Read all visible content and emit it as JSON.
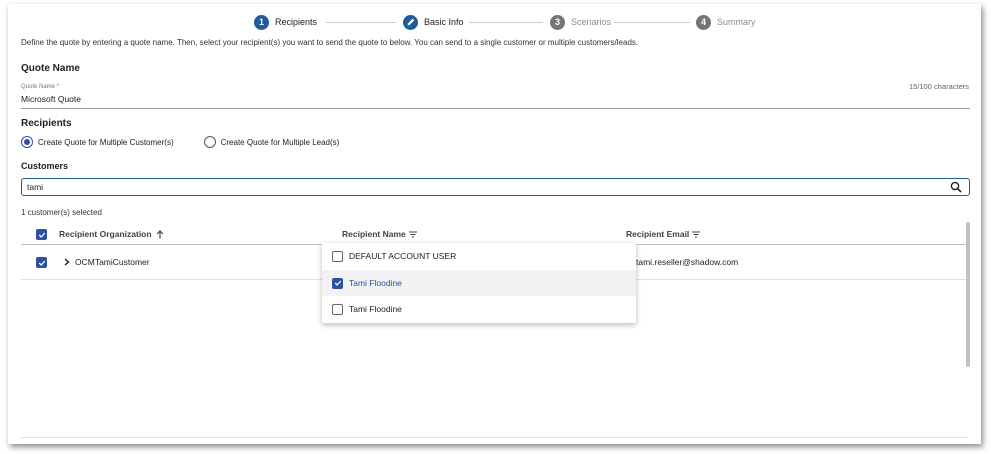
{
  "stepper": {
    "steps": [
      {
        "number": "1",
        "label": "Recipients",
        "state": "active"
      },
      {
        "number": "",
        "label": "Basic Info",
        "state": "done",
        "icon": "pencil-icon"
      },
      {
        "number": "3",
        "label": "Scenarios",
        "state": "todo"
      },
      {
        "number": "4",
        "label": "Summary",
        "state": "todo"
      }
    ]
  },
  "intro_text": "Define the quote by entering a quote name. Then, select your recipient(s) you want to send the quote to below. You can send to a single customer or multiple customers/leads.",
  "quote_name": {
    "section_title": "Quote Name",
    "field_label": "Quote Name *",
    "value": "Microsoft Quote",
    "char_count": "15/100 characters"
  },
  "recipients": {
    "section_title": "Recipients",
    "options": [
      {
        "label": "Create Quote for Multiple Customer(s)",
        "selected": true
      },
      {
        "label": "Create Quote for Multiple Lead(s)",
        "selected": false
      }
    ]
  },
  "customers": {
    "section_title": "Customers",
    "search_value": "tami",
    "search_icon": "search-icon",
    "selected_count": "1 customer(s) selected"
  },
  "table": {
    "columns": [
      {
        "label": "Recipient Organization",
        "icon": "arrow-up-icon"
      },
      {
        "label": "Recipient Name",
        "icon": "filter-icon"
      },
      {
        "label": "Recipient Email",
        "icon": "filter-icon"
      }
    ],
    "header_checked": true,
    "rows": [
      {
        "checked": true,
        "organization": "OCMTamiCustomer",
        "name": "",
        "email": "tami.reseller@shadow.com"
      }
    ]
  },
  "name_dropdown": {
    "options": [
      {
        "label": "DEFAULT ACCOUNT USER",
        "checked": false
      },
      {
        "label": "Tami Floodine",
        "checked": true
      },
      {
        "label": "Tami Floodine",
        "checked": false
      }
    ]
  },
  "colors": {
    "primary": "#1f5c99",
    "checkbox": "#2e4fa3",
    "inactive_step": "#757575"
  }
}
